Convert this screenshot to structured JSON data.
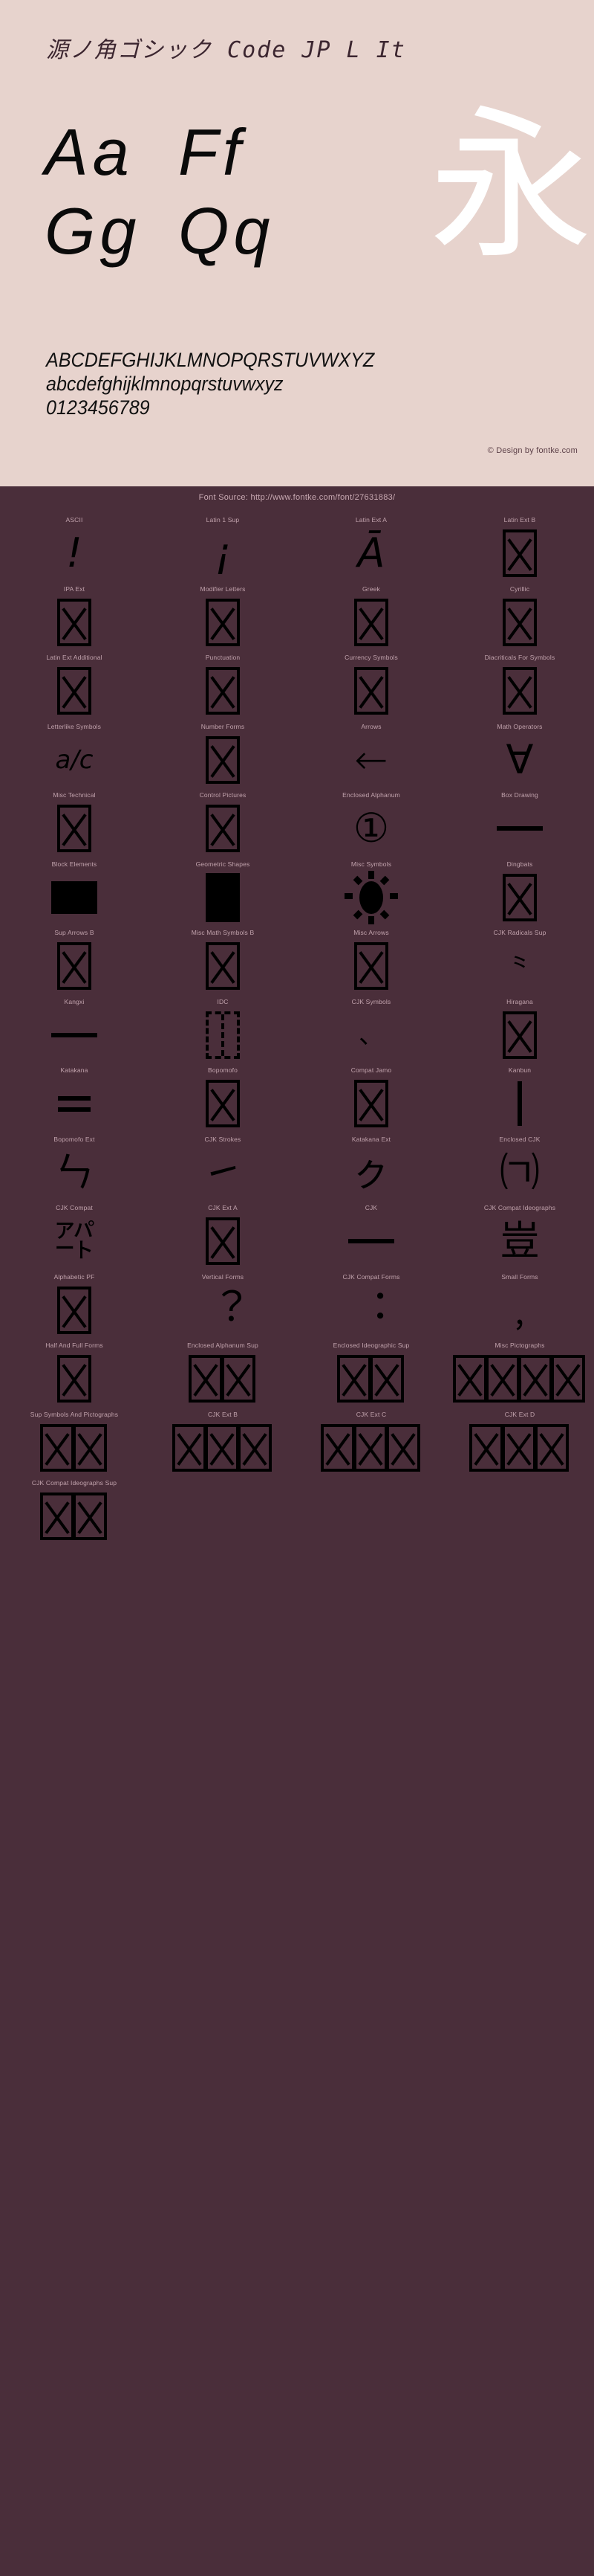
{
  "header": {
    "font_title": "源ノ角ゴシック Code JP L It",
    "sample_line_1": [
      "Aa",
      "Ff"
    ],
    "sample_line_2": [
      "Gg",
      "Qq"
    ],
    "kanji_sample": "永",
    "uppercase": "ABCDEFGHIJKLMNOPQRSTUVWXYZ",
    "lowercase": "abcdefghijklmnopqrstuvwxyz",
    "digits": "0123456789",
    "credit": "© Design by fontke.com",
    "background_color": "#e7d3cd",
    "text_color": "#111111",
    "kanji_color": "#ffffff"
  },
  "source_bar": {
    "text": "Font Source: http://www.fontke.com/font/27631883/",
    "background_color": "#4a2e3a",
    "text_color": "#c9aab3"
  },
  "grid": {
    "columns": 4,
    "cells": [
      {
        "label": "ASCII",
        "glyph": "!",
        "style": "lg ital"
      },
      {
        "label": "Latin 1 Sup",
        "glyph": "¡",
        "style": "lg ital"
      },
      {
        "label": "Latin Ext A",
        "glyph": "Ā",
        "style": "lg ital"
      },
      {
        "label": "Latin Ext B",
        "glyph": "",
        "style": "notdef"
      },
      {
        "label": "IPA Ext",
        "glyph": "",
        "style": "notdef"
      },
      {
        "label": "Modifier Letters",
        "glyph": "",
        "style": "notdef"
      },
      {
        "label": "Greek",
        "glyph": "",
        "style": "notdef"
      },
      {
        "label": "Cyrillic",
        "glyph": "",
        "style": "notdef"
      },
      {
        "label": "Latin Ext Additional",
        "glyph": "",
        "style": "notdef"
      },
      {
        "label": "Punctuation",
        "glyph": "",
        "style": "notdef"
      },
      {
        "label": "Currency Symbols",
        "glyph": "",
        "style": "notdef"
      },
      {
        "label": "Diacriticals For Symbols",
        "glyph": "",
        "style": "notdef"
      },
      {
        "label": "Letterlike Symbols",
        "glyph": "a/c",
        "style": "sm ital"
      },
      {
        "label": "Number Forms",
        "glyph": "",
        "style": "notdef"
      },
      {
        "label": "Arrows",
        "glyph": "←",
        "style": "lg"
      },
      {
        "label": "Math Operators",
        "glyph": "∀",
        "style": "lg ital"
      },
      {
        "label": "Misc Technical",
        "glyph": "",
        "style": "notdef"
      },
      {
        "label": "Control Pictures",
        "glyph": "",
        "style": "notdef"
      },
      {
        "label": "Enclosed Alphanum",
        "glyph": "①",
        "style": "lg"
      },
      {
        "label": "Box Drawing",
        "glyph": "─",
        "style": "dash-long"
      },
      {
        "label": "Block Elements",
        "glyph": "█",
        "style": "solid-block"
      },
      {
        "label": "Geometric Shapes",
        "glyph": "■",
        "style": "solid-tall"
      },
      {
        "label": "Misc Symbols",
        "glyph": "☀",
        "style": "sun"
      },
      {
        "label": "Dingbats",
        "glyph": "",
        "style": "notdef"
      },
      {
        "label": "Sup Arrows B",
        "glyph": "",
        "style": "notdef"
      },
      {
        "label": "Misc Math Symbols B",
        "glyph": "",
        "style": "notdef"
      },
      {
        "label": "Misc Arrows",
        "glyph": "",
        "style": "notdef"
      },
      {
        "label": "CJK Radicals Sup",
        "glyph": "⺀",
        "style": "sm"
      },
      {
        "label": "Kangxi",
        "glyph": "一",
        "style": "dash-long"
      },
      {
        "label": "IDC",
        "glyph": "⿰",
        "style": "notdef-dashed"
      },
      {
        "label": "CJK Symbols",
        "glyph": "、",
        "style": "sm"
      },
      {
        "label": "Hiragana",
        "glyph": "",
        "style": "notdef"
      },
      {
        "label": "Katakana",
        "glyph": "゠",
        "style": "dash-pair"
      },
      {
        "label": "Bopomofo",
        "glyph": "",
        "style": "notdef"
      },
      {
        "label": "Compat Jamo",
        "glyph": "",
        "style": "notdef"
      },
      {
        "label": "Kanbun",
        "glyph": "｜",
        "style": "vbar"
      },
      {
        "label": "Bopomofo Ext",
        "glyph": "ㄣ",
        "style": "lg"
      },
      {
        "label": "CJK Strokes",
        "glyph": "㇀",
        "style": "lg"
      },
      {
        "label": "Katakana Ext",
        "glyph": "ㇰ",
        "style": "lg"
      },
      {
        "label": "Enclosed CJK",
        "glyph": "㈀",
        "style": "lg"
      },
      {
        "label": "CJK Compat",
        "glyph": "㌀",
        "style": "lg"
      },
      {
        "label": "CJK Ext A",
        "glyph": "",
        "style": "notdef"
      },
      {
        "label": "CJK",
        "glyph": "一",
        "style": "dash-long"
      },
      {
        "label": "CJK Compat Ideographs",
        "glyph": "豈",
        "style": "lg"
      },
      {
        "label": "Alphabetic PF",
        "glyph": "",
        "style": "notdef"
      },
      {
        "label": "Vertical Forms",
        "glyph": "︖",
        "style": "lg"
      },
      {
        "label": "CJK Compat Forms",
        "glyph": "︓",
        "style": "lg"
      },
      {
        "label": "Small Forms",
        "glyph": "﹐",
        "style": "lg"
      },
      {
        "label": "Half And Full Forms",
        "glyph": "",
        "style": "notdef"
      },
      {
        "label": "Enclosed Alphanum Sup",
        "glyph": "🄀",
        "style": "notdef-2"
      },
      {
        "label": "Enclosed Ideographic Sup",
        "glyph": "🈀",
        "style": "notdef-2"
      },
      {
        "label": "Misc Pictographs",
        "glyph": "🌀",
        "style": "notdef-4"
      },
      {
        "label": "Sup Symbols And Pictographs",
        "glyph": "🠀",
        "style": "notdef-2"
      },
      {
        "label": "CJK Ext B",
        "glyph": "𠀀",
        "style": "notdef-3"
      },
      {
        "label": "CJK Ext C",
        "glyph": "𪜀",
        "style": "notdef-3"
      },
      {
        "label": "CJK Ext D",
        "glyph": "𫝀",
        "style": "notdef-3"
      },
      {
        "label": "CJK Compat Ideographs Sup",
        "glyph": "𪾀",
        "style": "notdef-2"
      }
    ]
  }
}
